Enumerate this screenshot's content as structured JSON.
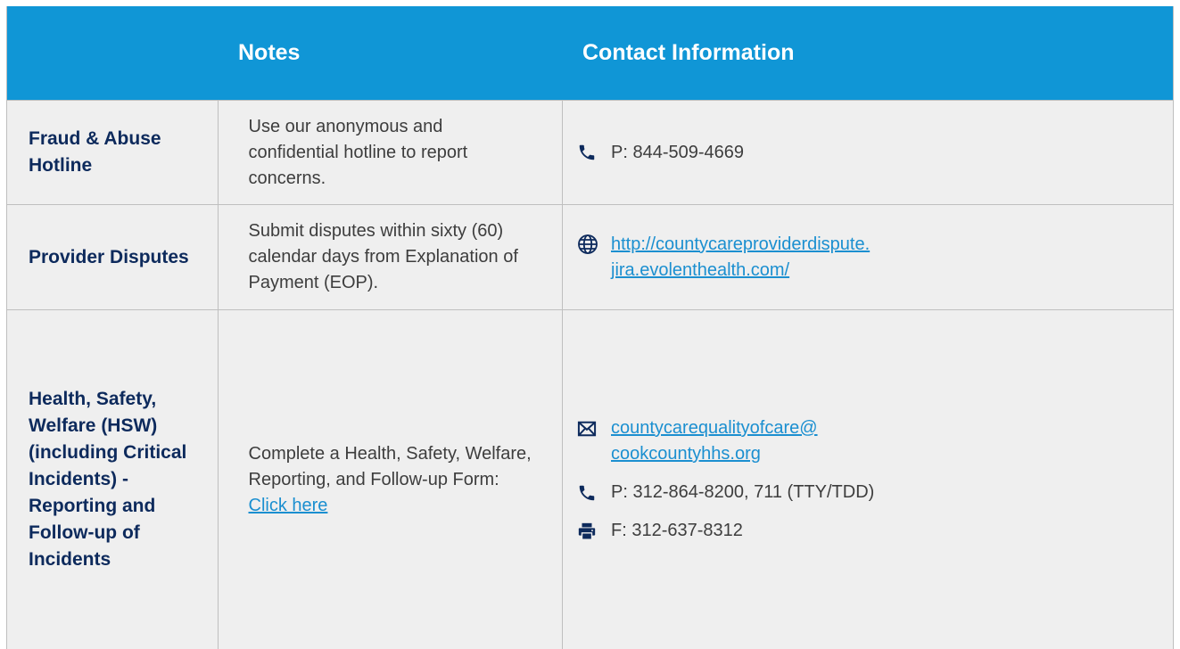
{
  "header": {
    "notes_label": "Notes",
    "contact_label": "Contact Information"
  },
  "colors": {
    "header_bg": "#1096d6",
    "row_bg": "#efefef",
    "title_text": "#0d2a5c",
    "link": "#1b8fd0"
  },
  "rows": [
    {
      "name": "Fraud & Abuse Hotline",
      "note": "Use our anonymous and confidential hotline to report concerns.",
      "phone": "P: 844-509-4669",
      "phone_icon": "phone-icon"
    },
    {
      "name": "Provider Disputes",
      "note": "Submit disputes within sixty (60) calendar days from Explanation of Payment (EOP).",
      "url_line1": "http://countycareproviderdispute.",
      "url_line2": "jira.evolenthealth.com/",
      "url_icon": "globe-icon"
    },
    {
      "name": "Health, Safety, Welfare (HSW) (including Critical Incidents) -Reporting and Follow-up of Incidents",
      "note_prefix": "Complete a Health, Safety, Welfare, Reporting, and Follow-up Form: ",
      "note_link": "Click here",
      "email_line1": "countycarequalityofcare@",
      "email_line2": "cookcountyhhs.org",
      "email_icon": "envelope-icon",
      "phone": "P: 312-864-8200, 711 (TTY/TDD)",
      "phone_icon": "phone-icon",
      "fax": "F: 312-637-8312",
      "fax_icon": "fax-icon"
    }
  ]
}
